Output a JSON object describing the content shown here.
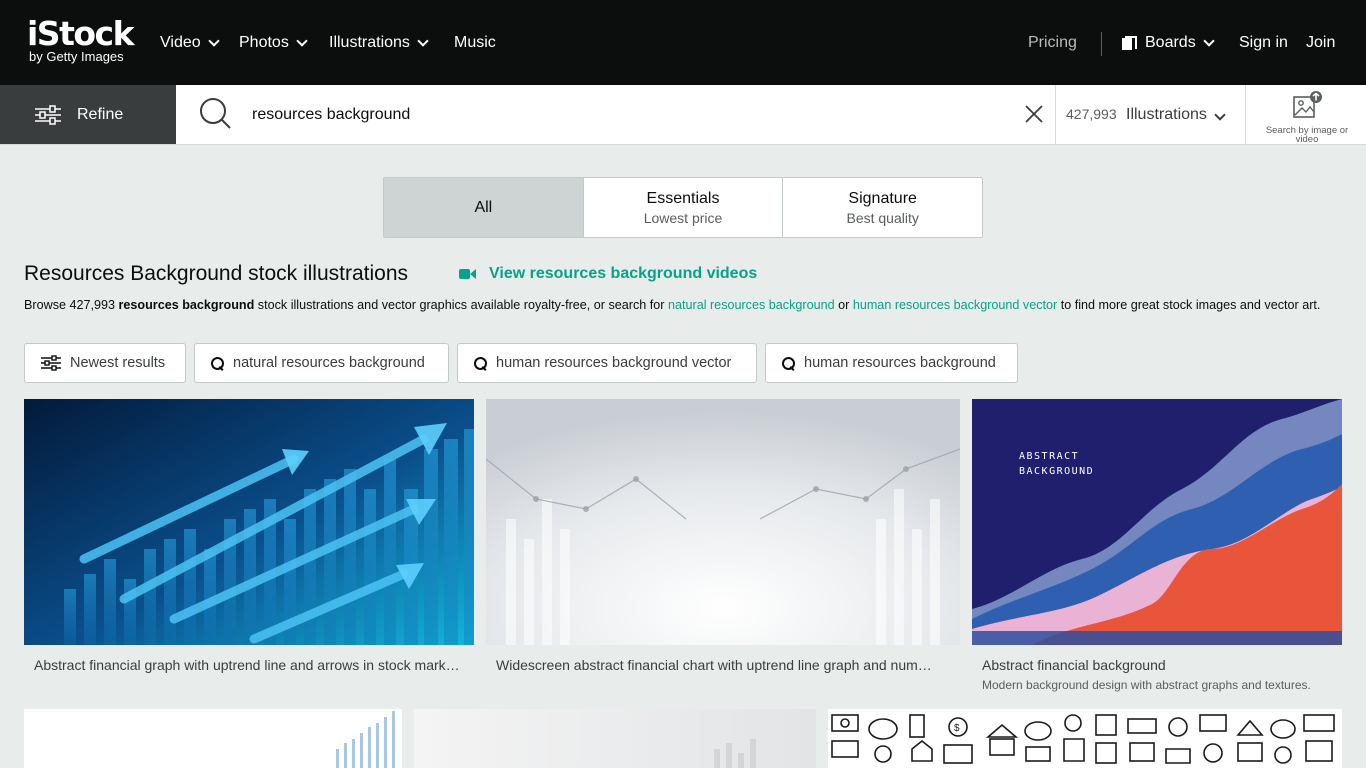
{
  "header": {
    "logo_main": "iStock",
    "logo_sub": "by Getty Images",
    "nav": [
      {
        "label": "Video",
        "dropdown": true
      },
      {
        "label": "Photos",
        "dropdown": true
      },
      {
        "label": "Illustrations",
        "dropdown": true
      },
      {
        "label": "Music",
        "dropdown": false
      }
    ],
    "pricing": "Pricing",
    "boards": "Boards",
    "sign_in": "Sign in",
    "join": "Join"
  },
  "search": {
    "refine_label": "Refine",
    "query": "resources background",
    "result_count": "427,993",
    "asset_type": "Illustrations",
    "search_by_image": "Search by image or video"
  },
  "tabs": [
    {
      "label": "All",
      "sub": "",
      "active": true
    },
    {
      "label": "Essentials",
      "sub": "Lowest price",
      "active": false
    },
    {
      "label": "Signature",
      "sub": "Best quality",
      "active": false
    }
  ],
  "results": {
    "title": "Resources Background stock illustrations",
    "video_link": "View resources background videos",
    "desc_before": "Browse 427,993 ",
    "desc_bold": "resources background",
    "desc_mid": " stock illustrations and vector graphics available royalty-free, or search for ",
    "desc_link1": "natural resources background",
    "desc_or": " or ",
    "desc_link2": "human resources background vector",
    "desc_after": " to find more great stock images and vector art."
  },
  "chips": [
    {
      "label": "Newest results",
      "icon": "sliders-icon"
    },
    {
      "label": "natural resources background",
      "icon": "search-icon"
    },
    {
      "label": "human resources background vector",
      "icon": "search-icon"
    },
    {
      "label": "human resources background",
      "icon": "search-icon"
    }
  ],
  "images": [
    {
      "caption": "Abstract financial graph with uptrend line and arrows in stock market on blue color background",
      "subcaption": ""
    },
    {
      "caption": "Widescreen abstract financial chart with uptrend line graph and numbers in stock market on gradient grey color background",
      "subcaption": ""
    },
    {
      "caption": "Abstract financial background",
      "subcaption": "Modern background design with abstract graphs and textures.",
      "overlay_text": "ABSTRACT BACKGROUND"
    }
  ],
  "colors": {
    "header_bg": "#0c0d0d",
    "accent": "#08a189",
    "page_bg": "#e8edec"
  }
}
